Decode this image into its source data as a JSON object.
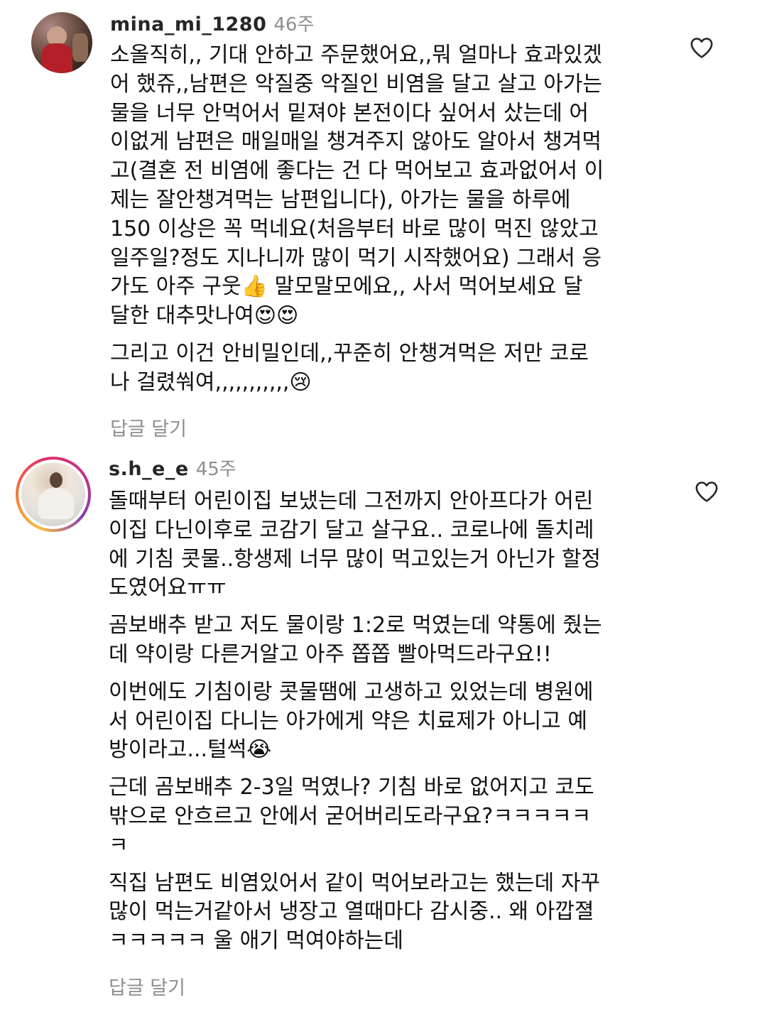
{
  "comments": [
    {
      "username": "mina_mi_1280",
      "timestamp": "46주",
      "paragraphs": [
        [
          "소올직히,, 기대 안하고 주문했어요,,뭐 얼마나 효과있겠",
          "어 했쥬,,남편은 악질중 악질인 비염을 달고 살고 아가는",
          "물을 너무 안먹어서 밑져야 본전이다 싶어서 샀는데 어",
          "이없게 남편은 매일매일 챙겨주지 않아도 알아서 챙겨먹",
          "고(결혼 전 비염에 좋다는 건 다 먹어보고 효과없어서 이",
          "제는 잘안챙겨먹는 남편입니다), 아가는 물을 하루에",
          "150 이상은 꼭 먹네요(처음부터 바로 많이 먹진 않았고",
          "일주일?정도 지나니까 많이 먹기 시작했어요) 그래서 응",
          "가도 아주 구웃👍 말모말모에요,, 사서 먹어보세요 달",
          "달한 대추맛나여😍😍"
        ],
        [
          "그리고 이건 안비밀인데,,꾸준히 안챙겨먹은 저만 코로",
          "나 걸렸쒀여,,,,,,,,,,,😢"
        ]
      ],
      "reply_label": "답글 달기",
      "like_icon": "heart-outline-icon"
    },
    {
      "username": "s.h_e_e",
      "timestamp": "45주",
      "paragraphs": [
        [
          "돌때부터 어린이집 보냈는데 그전까지 안아프다가 어린",
          "이집 다닌이후로 코감기 달고 살구요.. 코로나에 돌치레",
          "에 기침 콧물..항생제 너무 많이 먹고있는거 아닌가 할정",
          "도였어요ㅠㅠ"
        ],
        [
          "곰보배추 받고 저도 물이랑 1:2로 먹였는데 약통에 줬는",
          "데 약이랑 다른거알고 아주 쫍쫍 빨아먹드라구요!!"
        ],
        [
          "이번에도 기침이랑 콧물땜에 고생하고 있었는데 병원에",
          "서 어린이집 다니는 아가에게 약은 치료제가 아니고 예",
          "방이라고...털썩😭"
        ],
        [
          "근데 곰보배추 2-3일 먹였나? 기침 바로 없어지고 코도",
          "밖으로 안흐르고 안에서 굳어버리도라구요?ㅋㅋㅋㅋㅋ",
          "ㅋ"
        ],
        [
          "직집 남편도 비염있어서 같이 먹어보라고는 했는데 자꾸",
          "많이 먹는거같아서 냉장고 열때마다 감시중.. 왜 아깝졀",
          "ㅋㅋㅋㅋㅋ 울 애기 먹여야하는데"
        ]
      ],
      "reply_label": "답글 달기",
      "like_icon": "heart-outline-icon"
    }
  ]
}
